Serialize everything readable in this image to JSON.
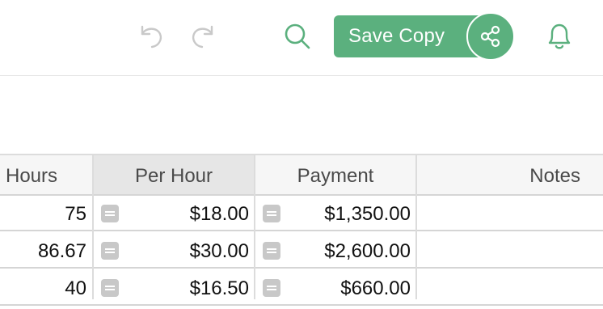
{
  "toolbar": {
    "icons": [
      "undo-icon",
      "redo-icon",
      "search-icon",
      "share-icon",
      "bell-icon"
    ],
    "save_copy_label": "Save Copy",
    "accent_color": "#5bb07e"
  },
  "table": {
    "columns": [
      "Hours",
      "Per Hour",
      "Payment",
      "Notes"
    ],
    "selected_column": "Per Hour",
    "rows": [
      {
        "hours": "75",
        "per_hour": "$18.00",
        "payment": "$1,350.00",
        "notes": ""
      },
      {
        "hours": "86.67",
        "per_hour": "$30.00",
        "payment": "$2,600.00",
        "notes": ""
      },
      {
        "hours": "40",
        "per_hour": "$16.50",
        "payment": "$660.00",
        "notes": ""
      }
    ]
  }
}
